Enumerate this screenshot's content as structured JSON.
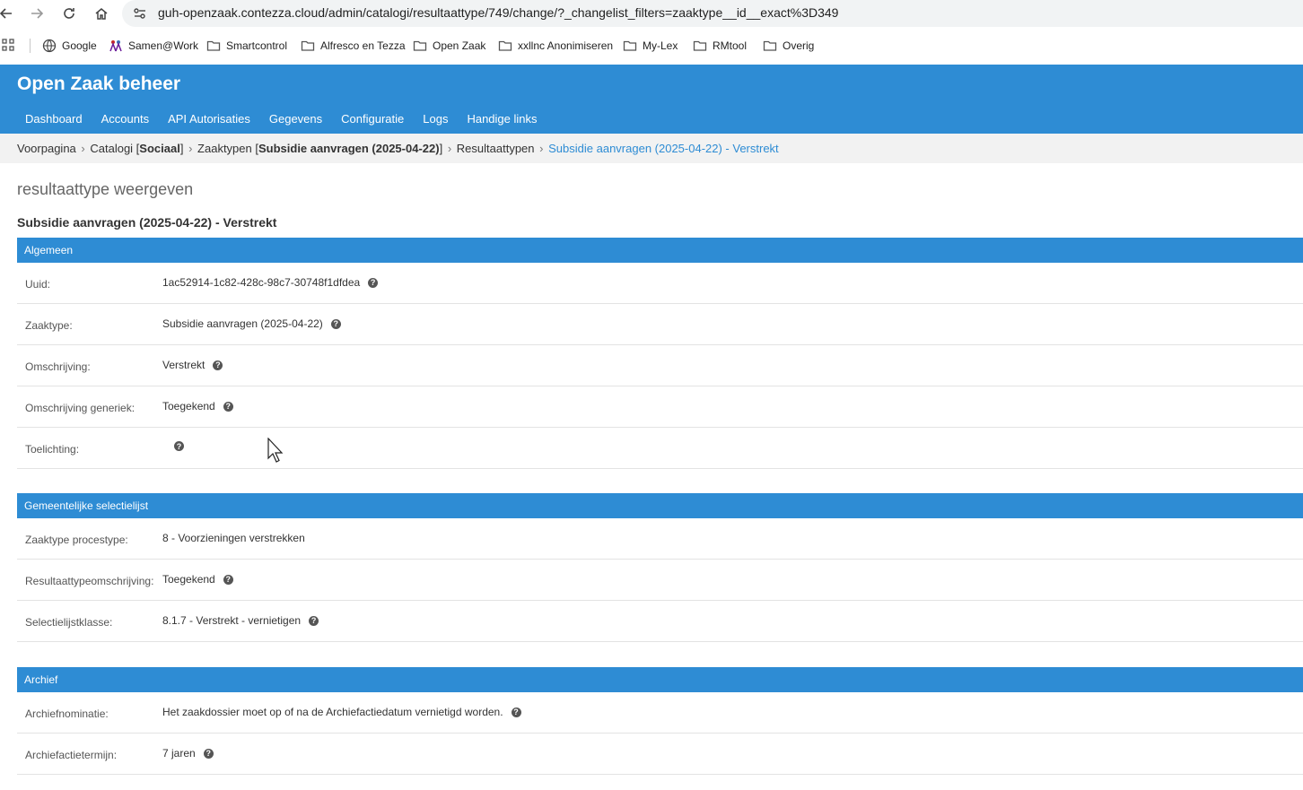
{
  "browser": {
    "url": "guh-openzaak.contezza.cloud/admin/catalogi/resultaattype/749/change/?_changelist_filters=zaaktype__id__exact%3D349",
    "bookmarks": [
      "Google",
      "Samen@Work",
      "Smartcontrol",
      "Alfresco en Tezza",
      "Open Zaak",
      "xxllnc Anonimiseren",
      "My-Lex",
      "RMtool",
      "Overig"
    ]
  },
  "header": {
    "branding": "Open Zaak beheer",
    "nav": [
      "Dashboard",
      "Accounts",
      "API Autorisaties",
      "Gegevens",
      "Configuratie",
      "Logs",
      "Handige links"
    ]
  },
  "breadcrumbs": {
    "home": "Voorpagina",
    "catalogi_prefix": "Catalogi [",
    "catalogi_name": "Sociaal",
    "catalogi_suffix": "]",
    "zaaktypen_prefix": "Zaaktypen [",
    "zaaktypen_name": "Subsidie aanvragen (2025-04-22)",
    "zaaktypen_suffix": "]",
    "resultaattypen": "Resultaattypen",
    "current": "Subsidie aanvragen (2025-04-22) - Verstrekt",
    "separator": "›"
  },
  "page": {
    "title": "resultaattype weergeven",
    "object_title": "Subsidie aanvragen (2025-04-22) - Verstrekt"
  },
  "fieldsets": {
    "algemeen": {
      "title": "Algemeen",
      "rows": [
        {
          "label": "Uuid:",
          "value": "1ac52914-1c82-428c-98c7-30748f1dfdea"
        },
        {
          "label": "Zaaktype:",
          "value": "Subsidie aanvragen (2025-04-22)"
        },
        {
          "label": "Omschrijving:",
          "value": "Verstrekt"
        },
        {
          "label": "Omschrijving generiek:",
          "value": "Toegekend"
        },
        {
          "label": "Toelichting:",
          "value": ""
        }
      ]
    },
    "selectielijst": {
      "title": "Gemeentelijke selectielijst",
      "rows": [
        {
          "label": "Zaaktype procestype:",
          "value": "8 - Voorzieningen verstrekken"
        },
        {
          "label": "Resultaattypeomschrijving:",
          "value": "Toegekend"
        },
        {
          "label": "Selectielijstklasse:",
          "value": "8.1.7 - Verstrekt - vernietigen"
        }
      ]
    },
    "archief": {
      "title": "Archief",
      "rows": [
        {
          "label": "Archiefnominatie:",
          "value": "Het zaakdossier moet op of na de Archiefactiedatum vernietigd worden."
        },
        {
          "label": "Archiefactietermijn:",
          "value": "7 jaren"
        }
      ]
    }
  },
  "help_icon": "?",
  "colors": {
    "primary": "#2e8cd4",
    "breadcrumb_bg": "#f2f2f2"
  }
}
